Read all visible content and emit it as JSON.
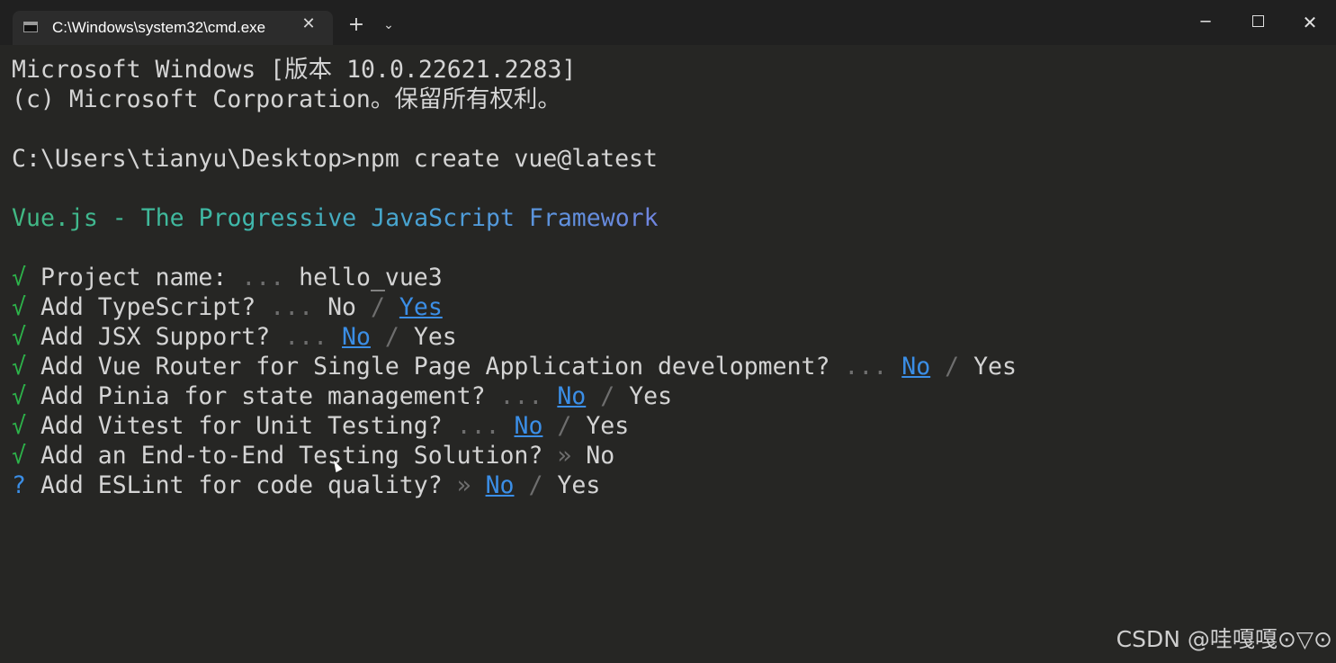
{
  "titlebar": {
    "tab_title": "C:\\Windows\\system32\\cmd.exe",
    "tab_close": "✕",
    "new_tab": "+",
    "dropdown": "⌄",
    "minimize": "─",
    "close": "✕"
  },
  "terminal": {
    "header1": "Microsoft Windows [版本 10.0.22621.2283]",
    "header2": "(c) Microsoft Corporation。保留所有权利。",
    "prompt": "C:\\Users\\tianyu\\Desktop>",
    "command": "npm create vue@latest",
    "banner": "Vue.js - The Progressive JavaScript Framework",
    "check_mark": "√",
    "question_mark": "?",
    "ellipsis": "...",
    "arrow": "»",
    "slash": "/",
    "no": "No",
    "yes": "Yes",
    "questions": {
      "project_name": "Project name:",
      "project_value": "hello_vue3",
      "typescript": "Add TypeScript?",
      "jsx": "Add JSX Support?",
      "router": "Add Vue Router for Single Page Application development?",
      "pinia": "Add Pinia for state management?",
      "vitest": "Add Vitest for Unit Testing?",
      "e2e": "Add an End-to-End Testing Solution?",
      "eslint": "Add ESLint for code quality?"
    },
    "banner_gradient": [
      "#41b883",
      "#3fb9a8",
      "#4a9fd8",
      "#6f86e0"
    ],
    "check_color": "#2db34a",
    "link_color": "#3b8ee6"
  },
  "watermark": "CSDN @哇嘎嘎⊙▽⊙"
}
